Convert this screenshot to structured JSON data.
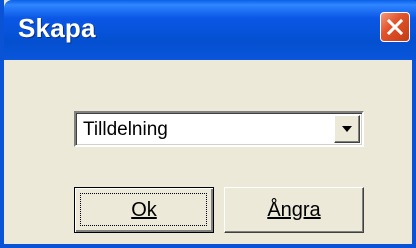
{
  "window": {
    "title": "Skapa",
    "close_icon": "close-icon"
  },
  "dialog": {
    "dropdown": {
      "selected": "Tilldelning",
      "arrow_icon": "chevron-down-icon"
    },
    "ok_label": "Ok",
    "cancel_label": "Ångra"
  },
  "colors": {
    "titlebar": "#0450d0",
    "close_button": "#e2542d",
    "dialog_background": "#ece9d8"
  }
}
